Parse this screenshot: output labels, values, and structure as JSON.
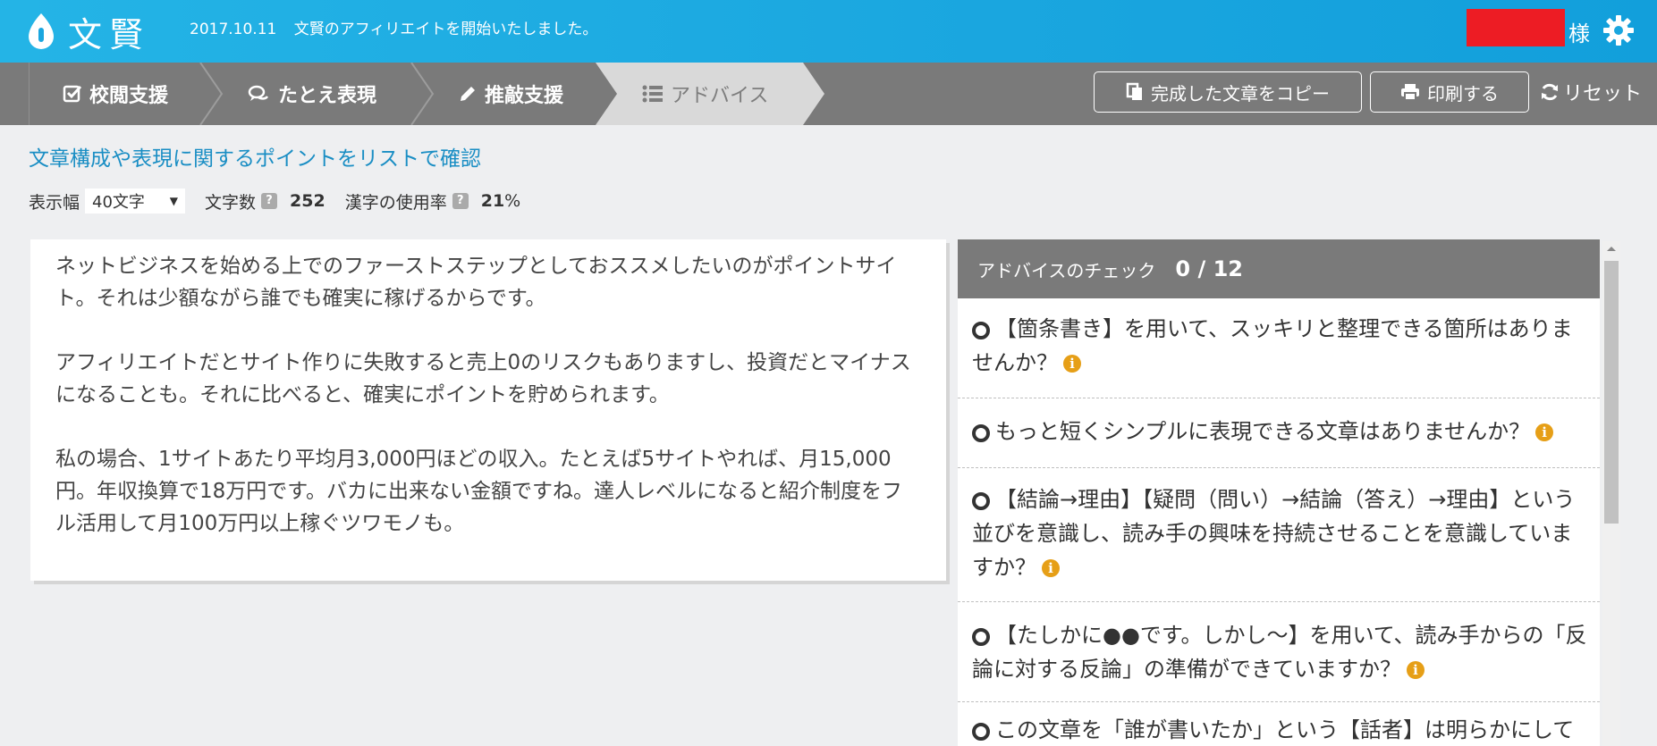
{
  "header": {
    "logo_text": "文賢",
    "news_date": "2017.10.11",
    "news_text": "文賢のアフィリエイトを開始いたしました。",
    "user_suffix": "様",
    "colors": {
      "header": "#1aa6df",
      "redaction": "#ed1c24"
    }
  },
  "toolbar": {
    "steps": [
      {
        "label": "校閲支援",
        "icon": "check-square-icon"
      },
      {
        "label": "たとえ表現",
        "icon": "speech-bubbles-icon"
      },
      {
        "label": "推敲支援",
        "icon": "pencil-icon"
      },
      {
        "label": "アドバイス",
        "icon": "list-icon",
        "active": true
      }
    ],
    "copy_label": "完成した文章をコピー",
    "print_label": "印刷する",
    "reset_label": "リセット"
  },
  "subtitle": "文章構成や表現に関するポイントをリストで確認",
  "controls": {
    "width_label": "表示幅",
    "width_value": "40文字",
    "char_count_label": "文字数",
    "char_count_value": "252",
    "kanji_rate_label": "漢字の使用率",
    "kanji_rate_value": "21",
    "kanji_rate_unit": "%",
    "help_mark": "?"
  },
  "editor": {
    "paragraphs": [
      "ネットビジネスを始める上でのファーストステップとしておススメしたいのがポイントサイト。それは少額ながら誰でも確実に稼げるからです。",
      "アフィリエイトだとサイト作りに失敗すると売上0のリスクもありますし、投資だとマイナスになることも。それに比べると、確実にポイントを貯められます。",
      "私の場合、1サイトあたり平均月3,000円ほどの収入。たとえば5サイトやれば、月15,000円。年収換算で18万円です。バカに出来ない金額ですね。達人レベルになると紹介制度をフル活用して月100万円以上稼ぐツワモノも。"
    ]
  },
  "advice": {
    "title": "アドバイスのチェック",
    "count": "0 / 12",
    "items": [
      "【箇条書き】を用いて、スッキリと整理できる箇所はありませんか？",
      "もっと短くシンプルに表現できる文章はありませんか？",
      "【結論→理由】【疑問（問い）→結論（答え）→理由】という並びを意識し、読み手の興味を持続させることを意識していますか？",
      "【たしかに●●です。しかし～】を用いて、読み手からの「反論に対する反論」の準備ができていますか？",
      "この文章を「誰が書いたか」という【話者】は明らかにして"
    ],
    "info_glyph": "i",
    "colors": {
      "info": "#e69f17"
    }
  }
}
